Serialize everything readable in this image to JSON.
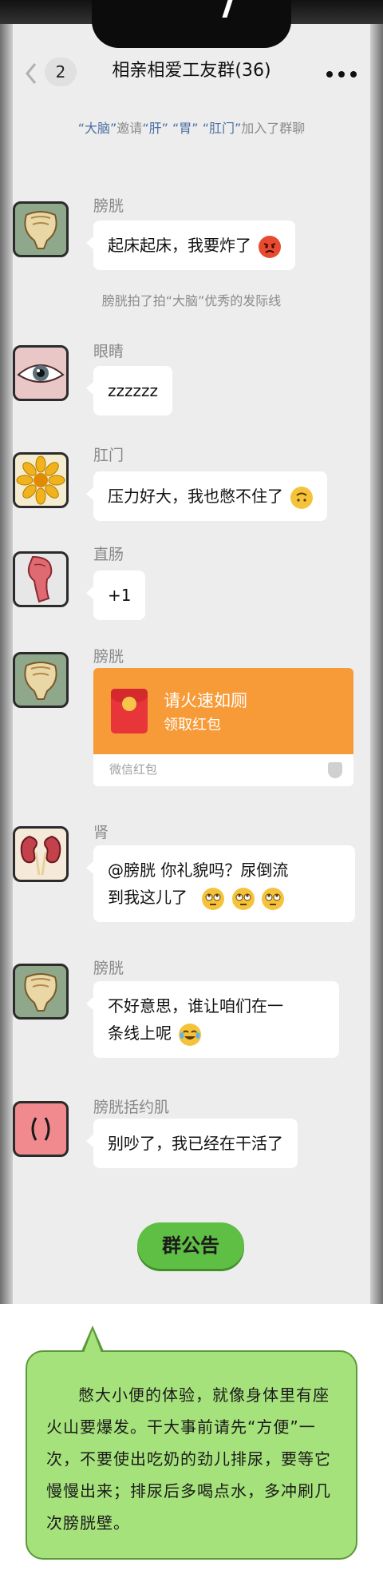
{
  "nav": {
    "back_icon": "chevron-left-icon",
    "unread_count": "2",
    "title": "相亲相爱工友群(36)",
    "more_icon": "more-dots-icon"
  },
  "system_messages": {
    "join": {
      "p1": "“大脑”",
      "p2": "邀请",
      "p3": "“肝”",
      "p4": "“胃”",
      "p5": "“肛门”",
      "p6": "加入了群聊"
    },
    "pat": "膀胱拍了拍“大脑”优秀的发际线"
  },
  "messages": [
    {
      "sender": "膀胱",
      "text": "起床起床，我要炸了",
      "emoji": "angry-face-icon"
    },
    {
      "sender": "眼睛",
      "text": "zzzzzz"
    },
    {
      "sender": "肛门",
      "text": "压力好大，我也憋不住了",
      "emoji": "upside-down-face-icon"
    },
    {
      "sender": "直肠",
      "text": "+1"
    },
    {
      "sender": "膀胱",
      "red_packet": {
        "title": "请火速如厕",
        "subtitle": "领取红包",
        "label": "微信红包"
      }
    },
    {
      "sender": "肾",
      "text_line1": "@膀胱  你礼貌吗？尿倒流",
      "text_line2": "到我这儿了",
      "emoji": "eye-roll-face-icon"
    },
    {
      "sender": "膀胱",
      "text_line1": "不好意思，谁让咱们在一",
      "text_line2": "条线上呢",
      "emoji": "tears-of-joy-face-icon"
    },
    {
      "sender": "膀胱括约肌",
      "text": "别吵了，我已经在干活了"
    }
  ],
  "announcement": {
    "label": "群公告",
    "body": "憋大小便的体验，就像身体里有座火山要爆发。干大事前请先“方便”一次，不要使出吃奶的劲儿排尿，要等它慢慢出来；排尿后多喝点水，多冲刷几次膀胱壁。"
  },
  "colors": {
    "chat_bg": "#ededed",
    "bubble": "#ffffff",
    "red_packet": "#f79b39",
    "announce_green": "#5fbe44",
    "note_green": "#a6e27c"
  }
}
